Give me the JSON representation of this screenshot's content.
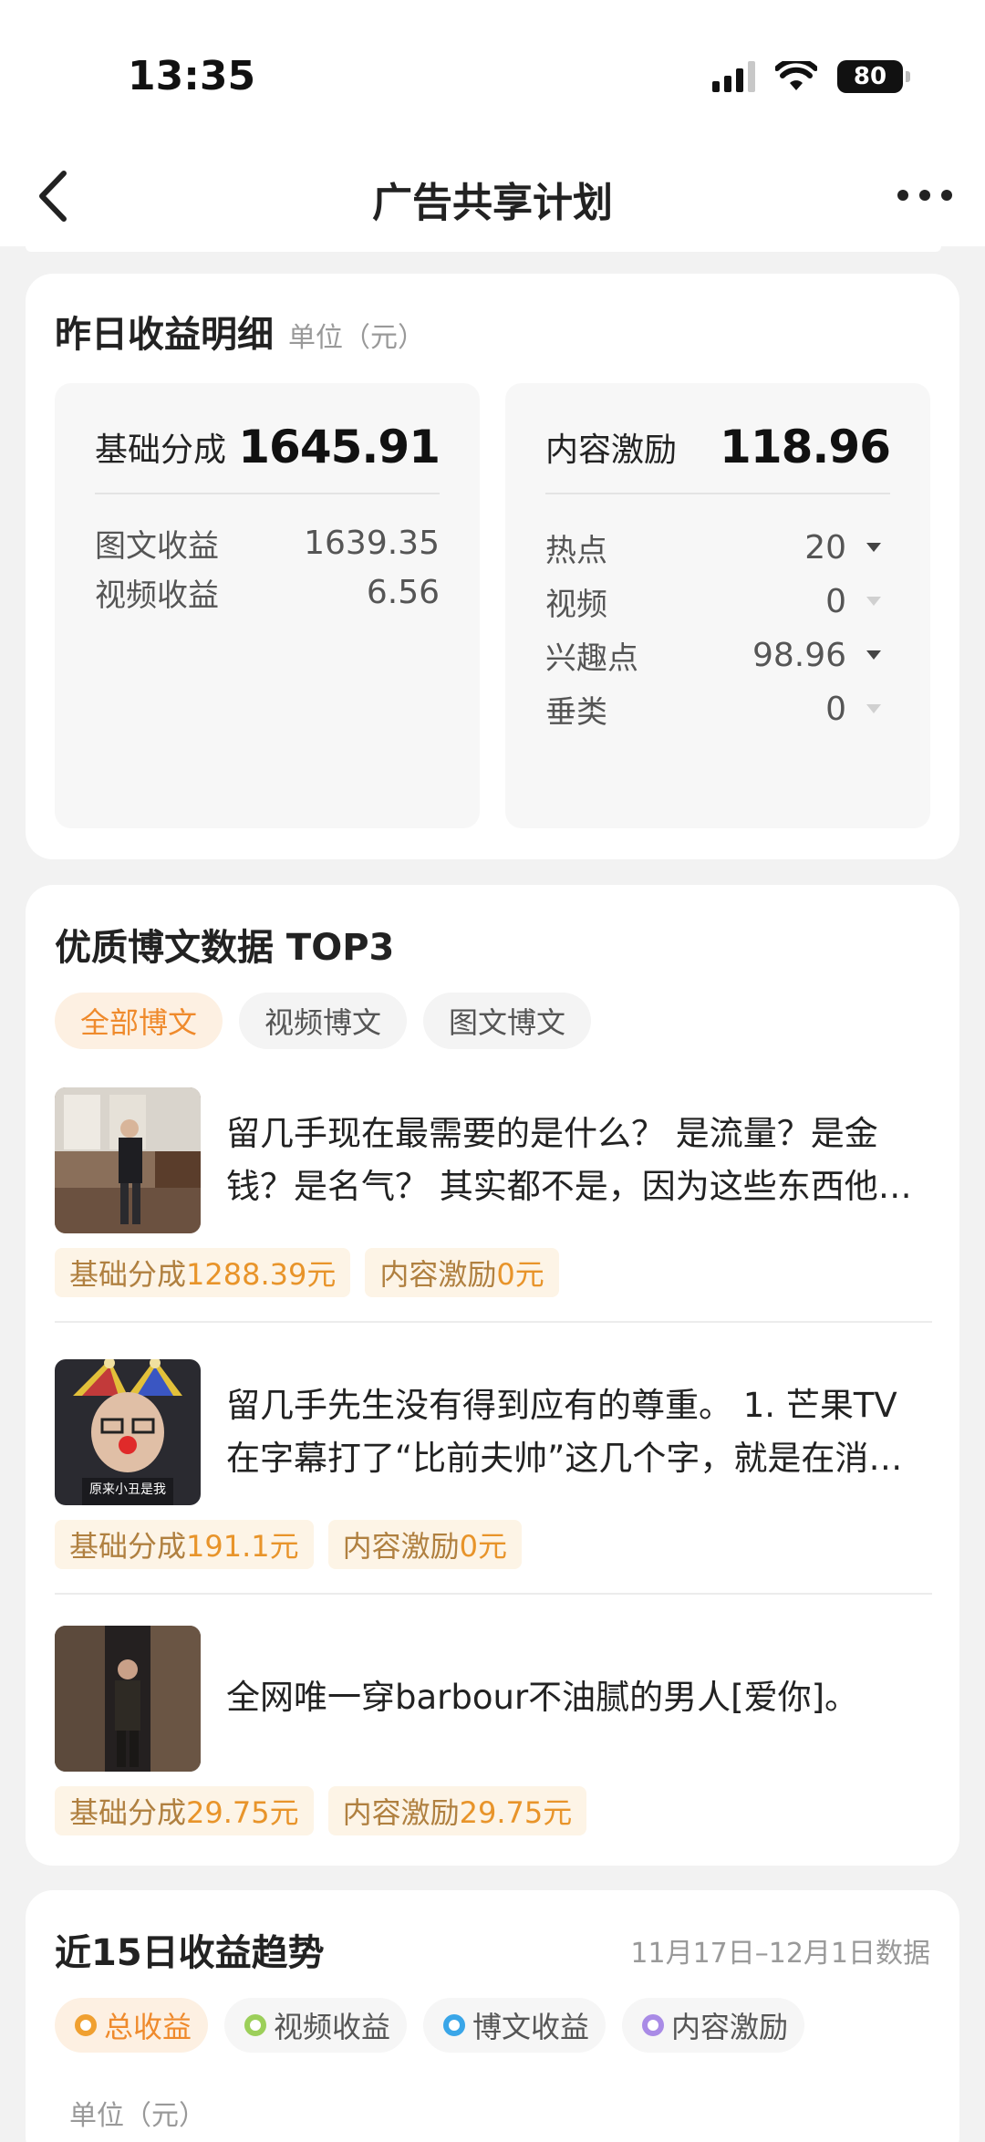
{
  "status_bar": {
    "time": "13:35",
    "battery": "80"
  },
  "nav": {
    "title": "广告共享计划"
  },
  "earnings": {
    "title": "昨日收益明细",
    "unit": "单位（元）",
    "base": {
      "label": "基础分成",
      "value": "1645.91",
      "rows": [
        {
          "label": "图文收益",
          "value": "1639.35"
        },
        {
          "label": "视频收益",
          "value": "6.56"
        }
      ]
    },
    "incentive": {
      "label": "内容激励",
      "value": "118.96",
      "rows": [
        {
          "label": "热点",
          "value": "20",
          "trend": "down"
        },
        {
          "label": "视频",
          "value": "0",
          "trend": "none"
        },
        {
          "label": "兴趣点",
          "value": "98.96",
          "trend": "down"
        },
        {
          "label": "垂类",
          "value": "0",
          "trend": "none"
        }
      ]
    }
  },
  "top3": {
    "title": "优质博文数据 TOP3",
    "tabs": [
      "全部博文",
      "视频博文",
      "图文博文"
    ],
    "posts": [
      {
        "text": "留几手现在最需要的是什么？ 是流量？是金钱？是名气？ 其实都不是，因为这些东西他以前都有过",
        "base_label": "基础分成",
        "base_value": "1288.39元",
        "inc_label": "内容激励",
        "inc_value": "0元"
      },
      {
        "text": "留几手先生没有得到应有的尊重。 1. 芒果TV在字幕打了“比前夫帅”这几个字，就是在消费他",
        "thumb_caption": "原来小丑是我",
        "base_label": "基础分成",
        "base_value": "191.1元",
        "inc_label": "内容激励",
        "inc_value": "0元"
      },
      {
        "text": "全网唯一穿barbour不油腻的男人[爱你]。",
        "base_label": "基础分成",
        "base_value": "29.75元",
        "inc_label": "内容激励",
        "inc_value": "29.75元"
      }
    ]
  },
  "trend": {
    "title": "近15日收益趋势",
    "range": "11月17日–12月1日数据",
    "legend": [
      {
        "label": "总收益",
        "color": "#f0a030"
      },
      {
        "label": "视频收益",
        "color": "#9ccf5a"
      },
      {
        "label": "博文收益",
        "color": "#3aa6e8"
      },
      {
        "label": "内容激励",
        "color": "#a98be6"
      }
    ],
    "unit": "单位（元）"
  }
}
